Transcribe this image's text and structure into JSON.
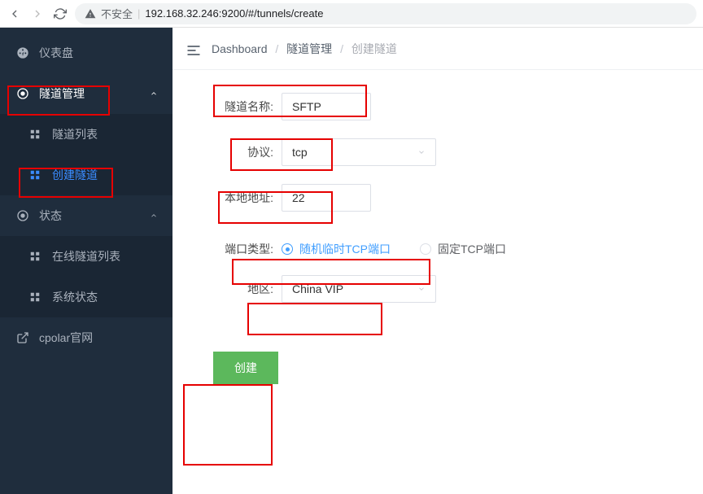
{
  "browser": {
    "insecure_label": "不安全",
    "url_ip": "192.168.32.246",
    "url_rest": ":9200/#/tunnels/create"
  },
  "sidebar": {
    "dashboard": "仪表盘",
    "tunnel_mgmt": "隧道管理",
    "tunnel_list": "隧道列表",
    "create_tunnel": "创建隧道",
    "status": "状态",
    "online_list": "在线隧道列表",
    "sys_status": "系统状态",
    "cpolar_site": "cpolar官网"
  },
  "breadcrumb": {
    "dashboard": "Dashboard",
    "tunnel_mgmt": "隧道管理",
    "create_tunnel": "创建隧道"
  },
  "form": {
    "name_label": "隧道名称:",
    "name_value": "SFTP",
    "proto_label": "协议:",
    "proto_value": "tcp",
    "local_label": "本地地址:",
    "local_value": "22",
    "port_type_label": "端口类型:",
    "port_random": "随机临时TCP端口",
    "port_fixed": "固定TCP端口",
    "region_label": "地区:",
    "region_value": "China VIP",
    "submit": "创建"
  }
}
